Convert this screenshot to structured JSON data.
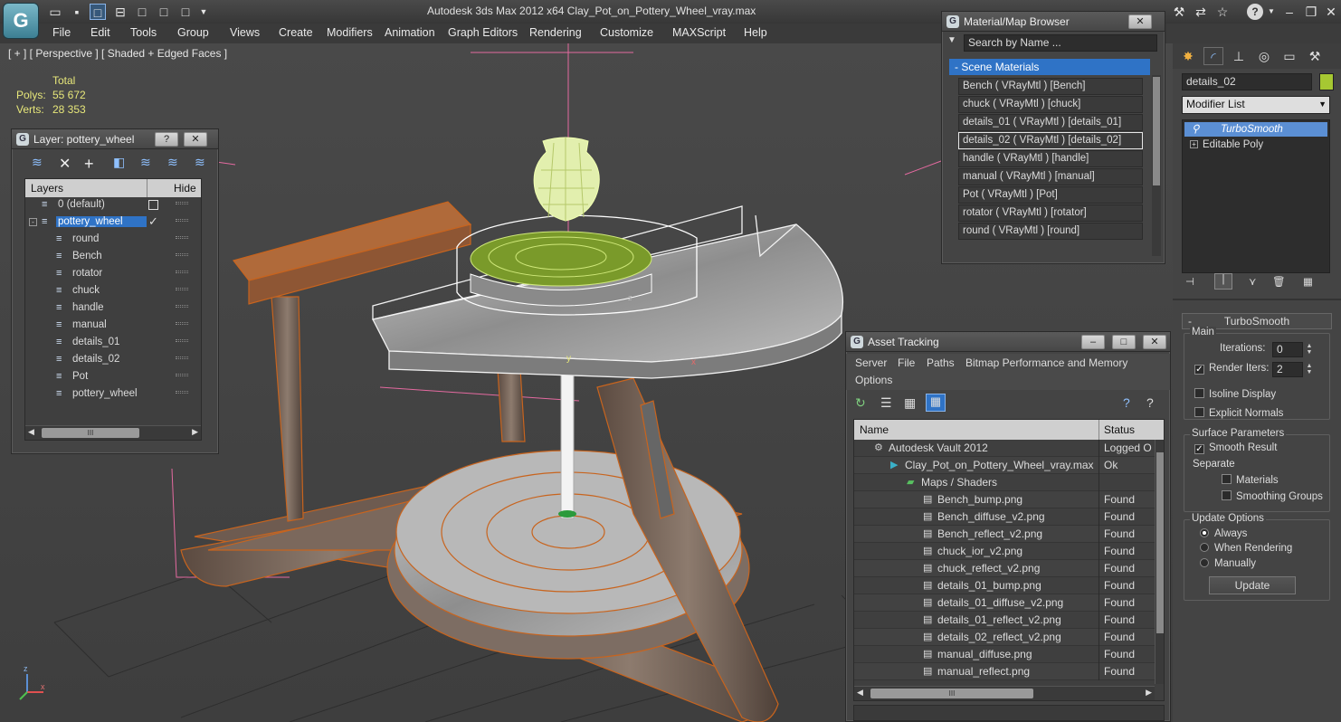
{
  "app": {
    "title": "Autodesk 3ds Max  2012 x64       Clay_Pot_on_Pottery_Wheel_vray.max",
    "logo": "3ds-max-logo",
    "help_glyph": "?"
  },
  "menu": [
    "File",
    "Edit",
    "Tools",
    "Group",
    "Views",
    "Create",
    "Modifiers",
    "Animation",
    "Graph Editors",
    "Rendering",
    "Customize",
    "MAXScript",
    "Help"
  ],
  "viewport": {
    "label": "[ + ] [ Perspective ] [ Shaded + Edged Faces ]",
    "stats_header": "Total",
    "polys_label": "Polys:",
    "polys_value": "55 672",
    "verts_label": "Verts:",
    "verts_value": "28 353",
    "axis_y": "y",
    "axis_x": "x",
    "axis_z": "z",
    "gizmo_x": "x",
    "gizmo_z": "z"
  },
  "layer_panel": {
    "title": "Layer: pottery_wheel",
    "help": "?",
    "col_layers": "Layers",
    "col_hide": "Hide",
    "check_mark": "✓",
    "scroll_thumb": "III",
    "items": [
      {
        "label": "0 (default)",
        "indent": 1
      },
      {
        "label": "pottery_wheel",
        "indent": 1,
        "selected": true
      },
      {
        "label": "round",
        "indent": 2
      },
      {
        "label": "Bench",
        "indent": 2
      },
      {
        "label": "rotator",
        "indent": 2
      },
      {
        "label": "chuck",
        "indent": 2
      },
      {
        "label": "handle",
        "indent": 2
      },
      {
        "label": "manual",
        "indent": 2
      },
      {
        "label": "details_01",
        "indent": 2
      },
      {
        "label": "details_02",
        "indent": 2
      },
      {
        "label": "Pot",
        "indent": 2
      },
      {
        "label": "pottery_wheel",
        "indent": 2
      }
    ]
  },
  "material_browser": {
    "title": "Material/Map Browser",
    "search_placeholder": "Search by Name ...",
    "section": "- Scene Materials",
    "items": [
      "Bench  ( VRayMtl )  [Bench]",
      "chuck  ( VRayMtl )  [chuck]",
      "details_01  ( VRayMtl )  [details_01]",
      "details_02  ( VRayMtl )  [details_02]",
      "handle  ( VRayMtl )  [handle]",
      "manual  ( VRayMtl )  [manual]",
      "Pot  ( VRayMtl )  [Pot]",
      "rotator  ( VRayMtl )  [rotator]",
      "round  ( VRayMtl )  [round]"
    ],
    "selected_index": 3
  },
  "asset_tracking": {
    "title": "Asset Tracking",
    "menu": [
      "Server",
      "File",
      "Paths",
      "Bitmap Performance and Memory"
    ],
    "menu2": "Options",
    "col_name": "Name",
    "col_status": "Status",
    "scroll_thumb": "III",
    "rows": [
      {
        "name": "Autodesk Vault 2012",
        "status": "Logged O",
        "level": 0,
        "icon": "vault-icon"
      },
      {
        "name": "Clay_Pot_on_Pottery_Wheel_vray.max",
        "status": "Ok",
        "level": 1,
        "icon": "max-file-icon"
      },
      {
        "name": "Maps / Shaders",
        "status": "",
        "level": 2,
        "icon": "maps-folder-icon"
      },
      {
        "name": "Bench_bump.png",
        "status": "Found",
        "level": 3,
        "icon": "bitmap-icon"
      },
      {
        "name": "Bench_diffuse_v2.png",
        "status": "Found",
        "level": 3,
        "icon": "bitmap-icon"
      },
      {
        "name": "Bench_reflect_v2.png",
        "status": "Found",
        "level": 3,
        "icon": "bitmap-icon"
      },
      {
        "name": "chuck_ior_v2.png",
        "status": "Found",
        "level": 3,
        "icon": "bitmap-icon"
      },
      {
        "name": "chuck_reflect_v2.png",
        "status": "Found",
        "level": 3,
        "icon": "bitmap-icon"
      },
      {
        "name": "details_01_bump.png",
        "status": "Found",
        "level": 3,
        "icon": "bitmap-icon"
      },
      {
        "name": "details_01_diffuse_v2.png",
        "status": "Found",
        "level": 3,
        "icon": "bitmap-icon"
      },
      {
        "name": "details_01_reflect_v2.png",
        "status": "Found",
        "level": 3,
        "icon": "bitmap-icon"
      },
      {
        "name": "details_02_reflect_v2.png",
        "status": "Found",
        "level": 3,
        "icon": "bitmap-icon"
      },
      {
        "name": "manual_diffuse.png",
        "status": "Found",
        "level": 3,
        "icon": "bitmap-icon"
      },
      {
        "name": "manual_reflect.png",
        "status": "Found",
        "level": 3,
        "icon": "bitmap-icon"
      }
    ]
  },
  "command_panel": {
    "object_name": "details_02",
    "object_color": "#a6c832",
    "modifier_list": "Modifier List",
    "stack": [
      "TurboSmooth",
      "Editable Poly"
    ],
    "rollout_title": "TurboSmooth",
    "main_label": "Main",
    "iterations_label": "Iterations:",
    "iterations_value": "0",
    "render_iters_label": "Render Iters:",
    "render_iters_value": "2",
    "isoline_label": "Isoline Display",
    "explicit_normals_label": "Explicit Normals",
    "surface_label": "Surface Parameters",
    "smooth_result_label": "Smooth Result",
    "separate_label": "Separate",
    "materials_label": "Materials",
    "smoothing_groups_label": "Smoothing Groups",
    "update_options_label": "Update Options",
    "always_label": "Always",
    "when_rendering_label": "When Rendering",
    "manually_label": "Manually",
    "update_button": "Update",
    "collapse_mark": "-"
  },
  "colors": {
    "accent": "#2f73c6",
    "selection": "#5b8fd4",
    "wire_orange": "#c8641e",
    "wire_white": "#f2f2f2"
  }
}
